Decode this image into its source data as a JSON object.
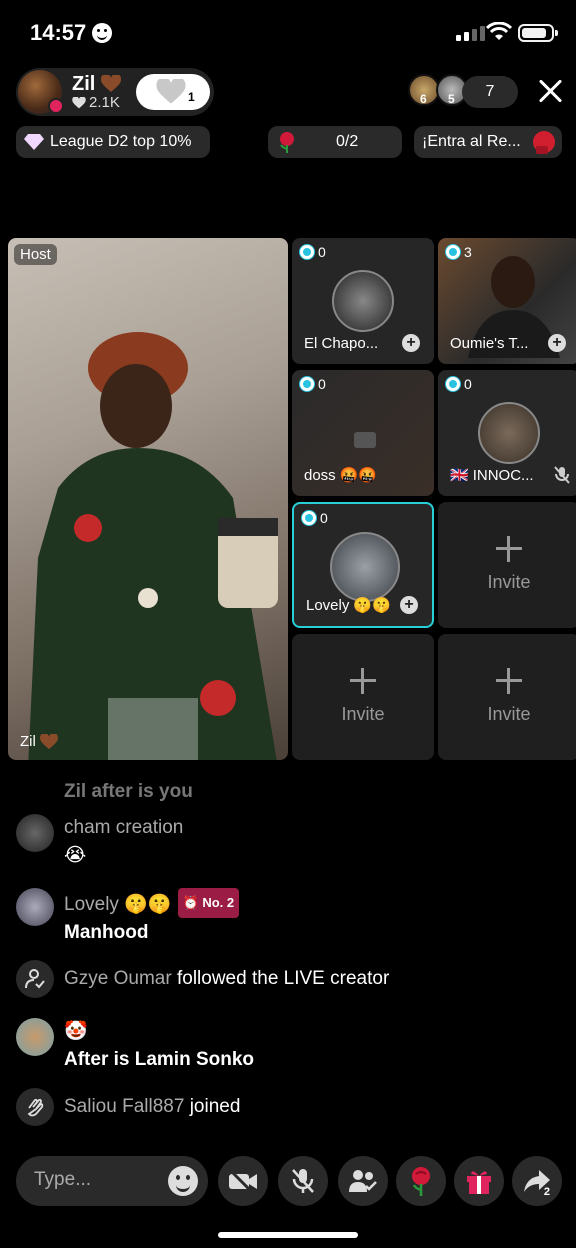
{
  "status_bar": {
    "time": "14:57"
  },
  "host": {
    "name": "Zil",
    "likes": "2.1K",
    "follow_count": "1",
    "heart": "brown-heart-icon"
  },
  "viewers": {
    "avatar_counts": [
      "6",
      "5"
    ],
    "count": "7"
  },
  "chips": {
    "league": "League D2 top 10%",
    "rose_progress": "0/2",
    "entra": "¡Entra al Re..."
  },
  "stage": {
    "host_label": "Host",
    "host_name": "Zil",
    "guests": [
      {
        "name": "El Chapo...",
        "score": "0"
      },
      {
        "name": "Oumie's T...",
        "score": "3"
      },
      {
        "name": "doss",
        "score": "0"
      },
      {
        "name": "INNOC...",
        "score": "0"
      },
      {
        "name": "Lovely",
        "score": "0"
      }
    ],
    "invite_label": "Invite"
  },
  "chat": [
    {
      "user": "Zil after is you",
      "text": ""
    },
    {
      "user": "cham creation",
      "text": "😭"
    },
    {
      "user": "Lovely",
      "rank": "No. 2",
      "text": "Manhood"
    },
    {
      "user": "Gzye Oumar",
      "text": "followed the LIVE creator"
    },
    {
      "user": "",
      "text": "After is Lamin Sonko"
    },
    {
      "user": "Saliou Fall887",
      "text": "joined"
    }
  ],
  "bottom": {
    "placeholder": "Type...",
    "share_count": "2"
  },
  "colors": {
    "accent": "#27d0d8",
    "rank": "#9b1c45",
    "gift": "#e0245e"
  }
}
